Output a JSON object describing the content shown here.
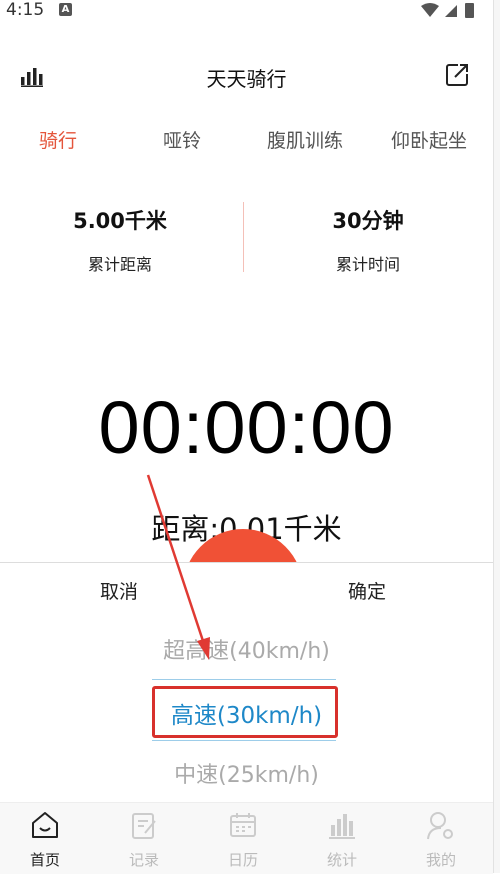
{
  "status": {
    "time": "4:15",
    "notif_icon": "A"
  },
  "header": {
    "title": "天天骑行",
    "left_icon": "stats-icon",
    "right_icon": "share-icon"
  },
  "tabs": [
    {
      "label": "骑行",
      "active": true
    },
    {
      "label": "哑铃",
      "active": false
    },
    {
      "label": "腹肌训练",
      "active": false
    },
    {
      "label": "仰卧起坐",
      "active": false
    }
  ],
  "summary": {
    "distance_value": "5.00千米",
    "distance_label": "累计距离",
    "time_value": "30分钟",
    "time_label": "累计时间"
  },
  "timer": "00:00:00",
  "distance_text": "距离:0.01千米",
  "picker": {
    "cancel": "取消",
    "confirm": "确定",
    "options": [
      "超高速(40km/h)",
      "高速(30km/h)",
      "中速(25km/h)"
    ],
    "selected_index": 1
  },
  "bottom_nav": [
    {
      "label": "首页",
      "icon": "home-icon",
      "active": true
    },
    {
      "label": "记录",
      "icon": "record-icon",
      "active": false
    },
    {
      "label": "日历",
      "icon": "calendar-icon",
      "active": false
    },
    {
      "label": "统计",
      "icon": "statistics-icon",
      "active": false
    },
    {
      "label": "我的",
      "icon": "profile-icon",
      "active": false
    }
  ],
  "colors": {
    "accent": "#e4553b",
    "selected_option": "#1e88c8",
    "annotation": "#d8312c"
  }
}
